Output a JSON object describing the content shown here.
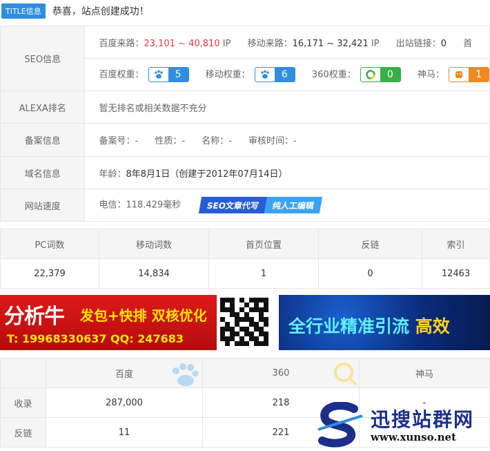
{
  "title": {
    "badge": "TITLE信息",
    "text": "恭喜，站点创建成功！"
  },
  "seo": {
    "label": "SEO信息",
    "baidu_traffic_label": "百度来路：",
    "baidu_traffic_value": "23,101 ~ 40,810",
    "baidu_traffic_unit": " IP",
    "mobile_traffic_label": "移动来路：",
    "mobile_traffic_value": "16,171 ~ 32,421",
    "mobile_traffic_unit": " IP",
    "outlinks_label": "出站链接：",
    "outlinks_value": "0",
    "outlinks_next": "首",
    "baidu_weight_label": "百度权重：",
    "baidu_weight_value": "5",
    "mobile_weight_label": "移动权重：",
    "mobile_weight_value": "6",
    "s360_weight_label": "360权重：",
    "s360_weight_value": "0",
    "shenma_label": "神马：",
    "shenma_value": "1"
  },
  "alexa": {
    "label": "ALEXA排名",
    "value": "暂无排名或相关数据不充分"
  },
  "beian": {
    "label": "备案信息",
    "number_label": "备案号：",
    "number_value": "-",
    "nature_label": "性质：",
    "nature_value": "-",
    "name_label": "名称：",
    "name_value": "-",
    "audit_label": "审核时间：",
    "audit_value": "-"
  },
  "domain": {
    "label": "域名信息",
    "age_label": "年龄：",
    "age_value": "8年8月1日（创建于2012年07月14日）"
  },
  "speed": {
    "label": "网站速度",
    "value": "电信：118.429毫秒",
    "banner_a": "SEO文章代写",
    "banner_b": "纯人工编辑"
  },
  "stats": {
    "headers": [
      "PC词数",
      "移动词数",
      "首页位置",
      "反链",
      "索引"
    ],
    "values": [
      "22,379",
      "14,834",
      "1",
      "0",
      "12463"
    ]
  },
  "ads": {
    "ad1_big": "分析牛",
    "ad1_mid": "发包+快排 双核优化",
    "ad1_tel": "T: 19968330637  QQ: 247683",
    "ad2_text": "全行业精准引流",
    "ad2_text_y": "高效"
  },
  "index_table": {
    "headers": [
      "",
      "百度",
      "360",
      "神马"
    ],
    "rows": [
      {
        "label": "收录",
        "baidu": "287,000",
        "s360": "218",
        "shenma": "-"
      },
      {
        "label": "反链",
        "baidu": "11",
        "s360": "221",
        "shenma": ""
      }
    ]
  },
  "watermark": {
    "name": "迅搜站群网",
    "url": "www.xunso.net"
  },
  "colors": {
    "accent": "#2f8ee0",
    "red": "#e4393c",
    "green": "#36b047",
    "orange": "#f08a1d"
  }
}
